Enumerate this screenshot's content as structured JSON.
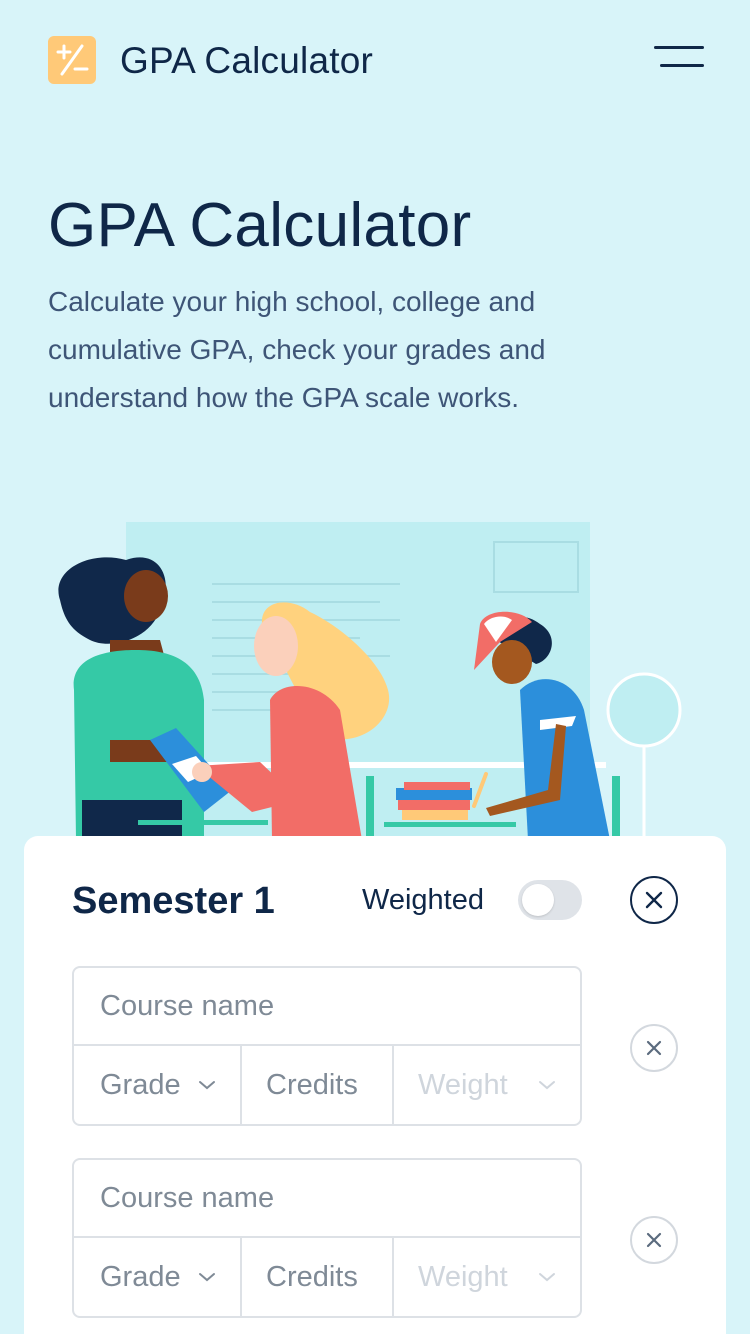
{
  "header": {
    "app_title": "GPA Calculator",
    "logo_icon": "plus-minus-icon",
    "menu_icon": "hamburger-menu-icon"
  },
  "hero": {
    "title": "GPA Calculator",
    "description": "Calculate your high school, college and cumulative GPA, check your grades and understand how the GPA scale works."
  },
  "semester": {
    "title": "Semester 1",
    "weighted_label": "Weighted",
    "weighted_on": false,
    "remove_icon": "close-circle-icon",
    "courses": [
      {
        "name_placeholder": "Course name",
        "grade": "Grade",
        "credits": "Credits",
        "weight": "Weight"
      },
      {
        "name_placeholder": "Course name",
        "grade": "Grade",
        "credits": "Credits",
        "weight": "Weight"
      }
    ]
  },
  "colors": {
    "background": "#d8f4f9",
    "text_primary": "#0f2748",
    "logo": "#ffc978",
    "card": "#ffffff"
  }
}
